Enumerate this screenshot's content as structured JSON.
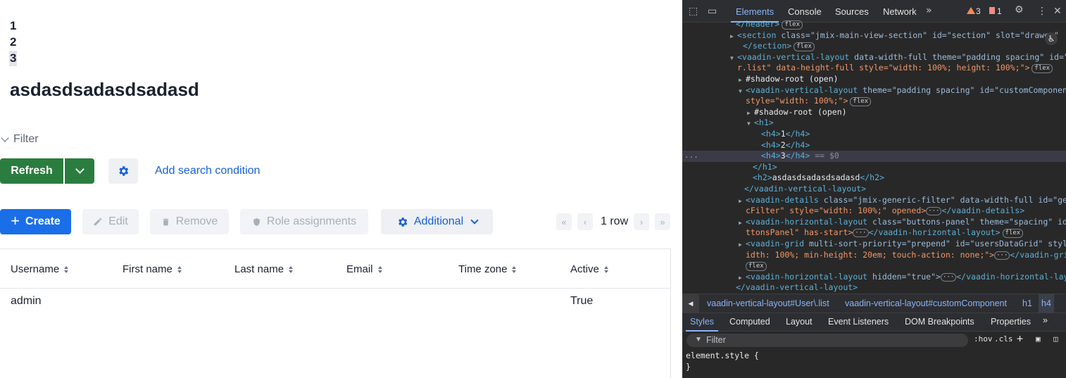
{
  "app": {
    "h4_items": [
      "1",
      "2",
      "3"
    ],
    "heading": "asdasdsadasdsadasd",
    "filter_label": "Filter",
    "refresh_label": "Refresh",
    "add_search_condition": "Add search condition",
    "create_label": "Create",
    "edit_label": "Edit",
    "remove_label": "Remove",
    "role_assignments_label": "Role assignments",
    "additional_label": "Additional",
    "row_count": "1 row",
    "grid": {
      "columns": [
        "Username",
        "First name",
        "Last name",
        "Email",
        "Time zone",
        "Active"
      ],
      "rows": [
        {
          "username": "admin",
          "first_name": "",
          "last_name": "",
          "email": "",
          "time_zone": "",
          "active": "True"
        }
      ]
    },
    "colors": {
      "primary": "#1a6ee8",
      "success": "#2a7d3e",
      "link": "#1660d6"
    }
  },
  "devtools": {
    "tabs": [
      "Elements",
      "Console",
      "Sources",
      "Network"
    ],
    "active_tab": "Elements",
    "warnings": "3",
    "errors": "1",
    "dom_lines": {
      "l0": "</header>",
      "l1_tag": "<section",
      "l1_attrs": " class=\"jmix-main-view-section\" id=\"section\" slot=\"drawer\"",
      "l2": "</section>",
      "l3a": "<vaadin-vertical-layout",
      "l3b": " data-width-full theme=\"padding spacing\" id=\"Use",
      "l4": "r.list\" data-height-full style=\"width: 100%; height: 100%;\">",
      "l5": "#shadow-root (open)",
      "l6a": "<vaadin-vertical-layout",
      "l6b": " theme=\"padding spacing\" id=\"customComponent\"",
      "l7": "style=\"width: 100%;\">",
      "l8": "#shadow-root (open)",
      "l9": "<h1>",
      "l10_open": "<h4>",
      "l10_text": "1",
      "l10_close": "</h4>",
      "l11_text": "2",
      "l12_text": "3",
      "l12_suffix": " == $0",
      "l13": "</h1>",
      "l14_open": "<h2>",
      "l14_text": "asdasdsadasdsadasd",
      "l14_close": "</h2>",
      "l15": "</vaadin-vertical-layout>",
      "l16a": "<vaadin-details",
      "l16b": " class=\"jmix-generic-filter\" data-width-full id=\"generi",
      "l17a": "cFilter\" style=\"width: 100%;\" opened>",
      "l17b": "</vaadin-details>",
      "l18a": "<vaadin-horizontal-layout",
      "l18b": " class=\"buttons-panel\" theme=\"spacing\" id=\"bu",
      "l19a": "ttonsPanel\" has-start>",
      "l19b": "</vaadin-horizontal-layout>",
      "l20a": "<vaadin-grid",
      "l20b": " multi-sort-priority=\"prepend\" id=\"usersDataGrid\" style=\"w",
      "l21": "idth: 100%; min-height: 20em; touch-action: none;\">",
      "l21b": "</vaadin-grid>",
      "l23a": "<vaadin-horizontal-layout",
      "l23b": " hidden=\"true\">",
      "l23c": "</vaadin-horizontal-layout>",
      "l24": "</vaadin-vertical-layout>",
      "badge": "flex"
    },
    "breadcrumbs": [
      "vaadin-vertical-layout#User\\.list",
      "vaadin-vertical-layout#customComponent",
      "h1",
      "h4"
    ],
    "sub_tabs": [
      "Styles",
      "Computed",
      "Layout",
      "Event Listeners",
      "DOM Breakpoints",
      "Properties"
    ],
    "filter_placeholder": "Filter",
    "hov": ":hov",
    "cls": ".cls",
    "element_style_open": "element.style {",
    "element_style_close": "}"
  }
}
